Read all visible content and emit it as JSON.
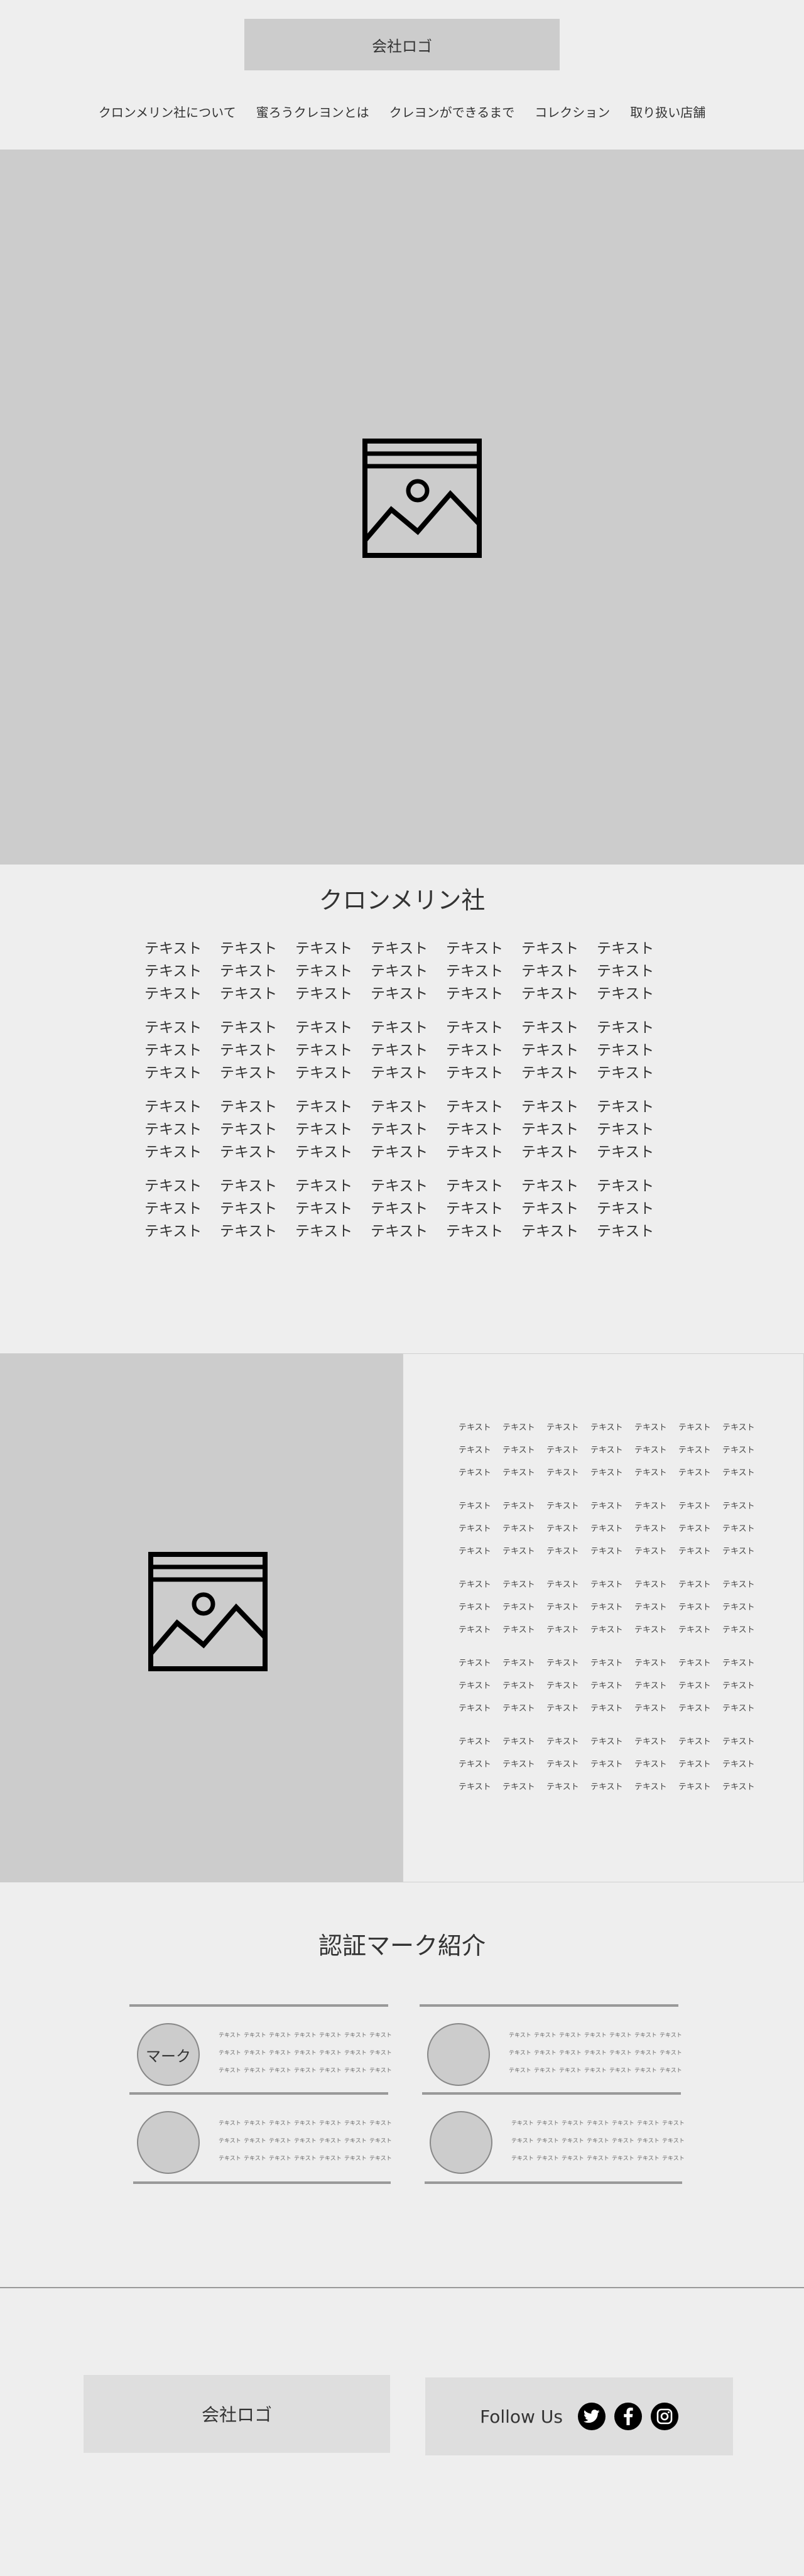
{
  "header": {
    "logo": "会社ロゴ",
    "nav": [
      "クロンメリン社について",
      "蜜ろうクレヨンとは",
      "クレヨンができるまで",
      "コレクション",
      "取り扱い店舗"
    ]
  },
  "hero": {
    "icon": "image-placeholder-icon"
  },
  "about": {
    "title": "クロンメリン社",
    "word": "テキスト"
  },
  "split": {
    "icon": "image-placeholder-icon",
    "word": "テキスト"
  },
  "cert": {
    "title": "認証マーク紹介",
    "mark_label": "マーク",
    "word": "テキスト"
  },
  "footer": {
    "logo": "会社ロゴ",
    "follow_label": "Follow Us",
    "social": [
      "twitter-icon",
      "facebook-icon",
      "instagram-icon"
    ]
  }
}
